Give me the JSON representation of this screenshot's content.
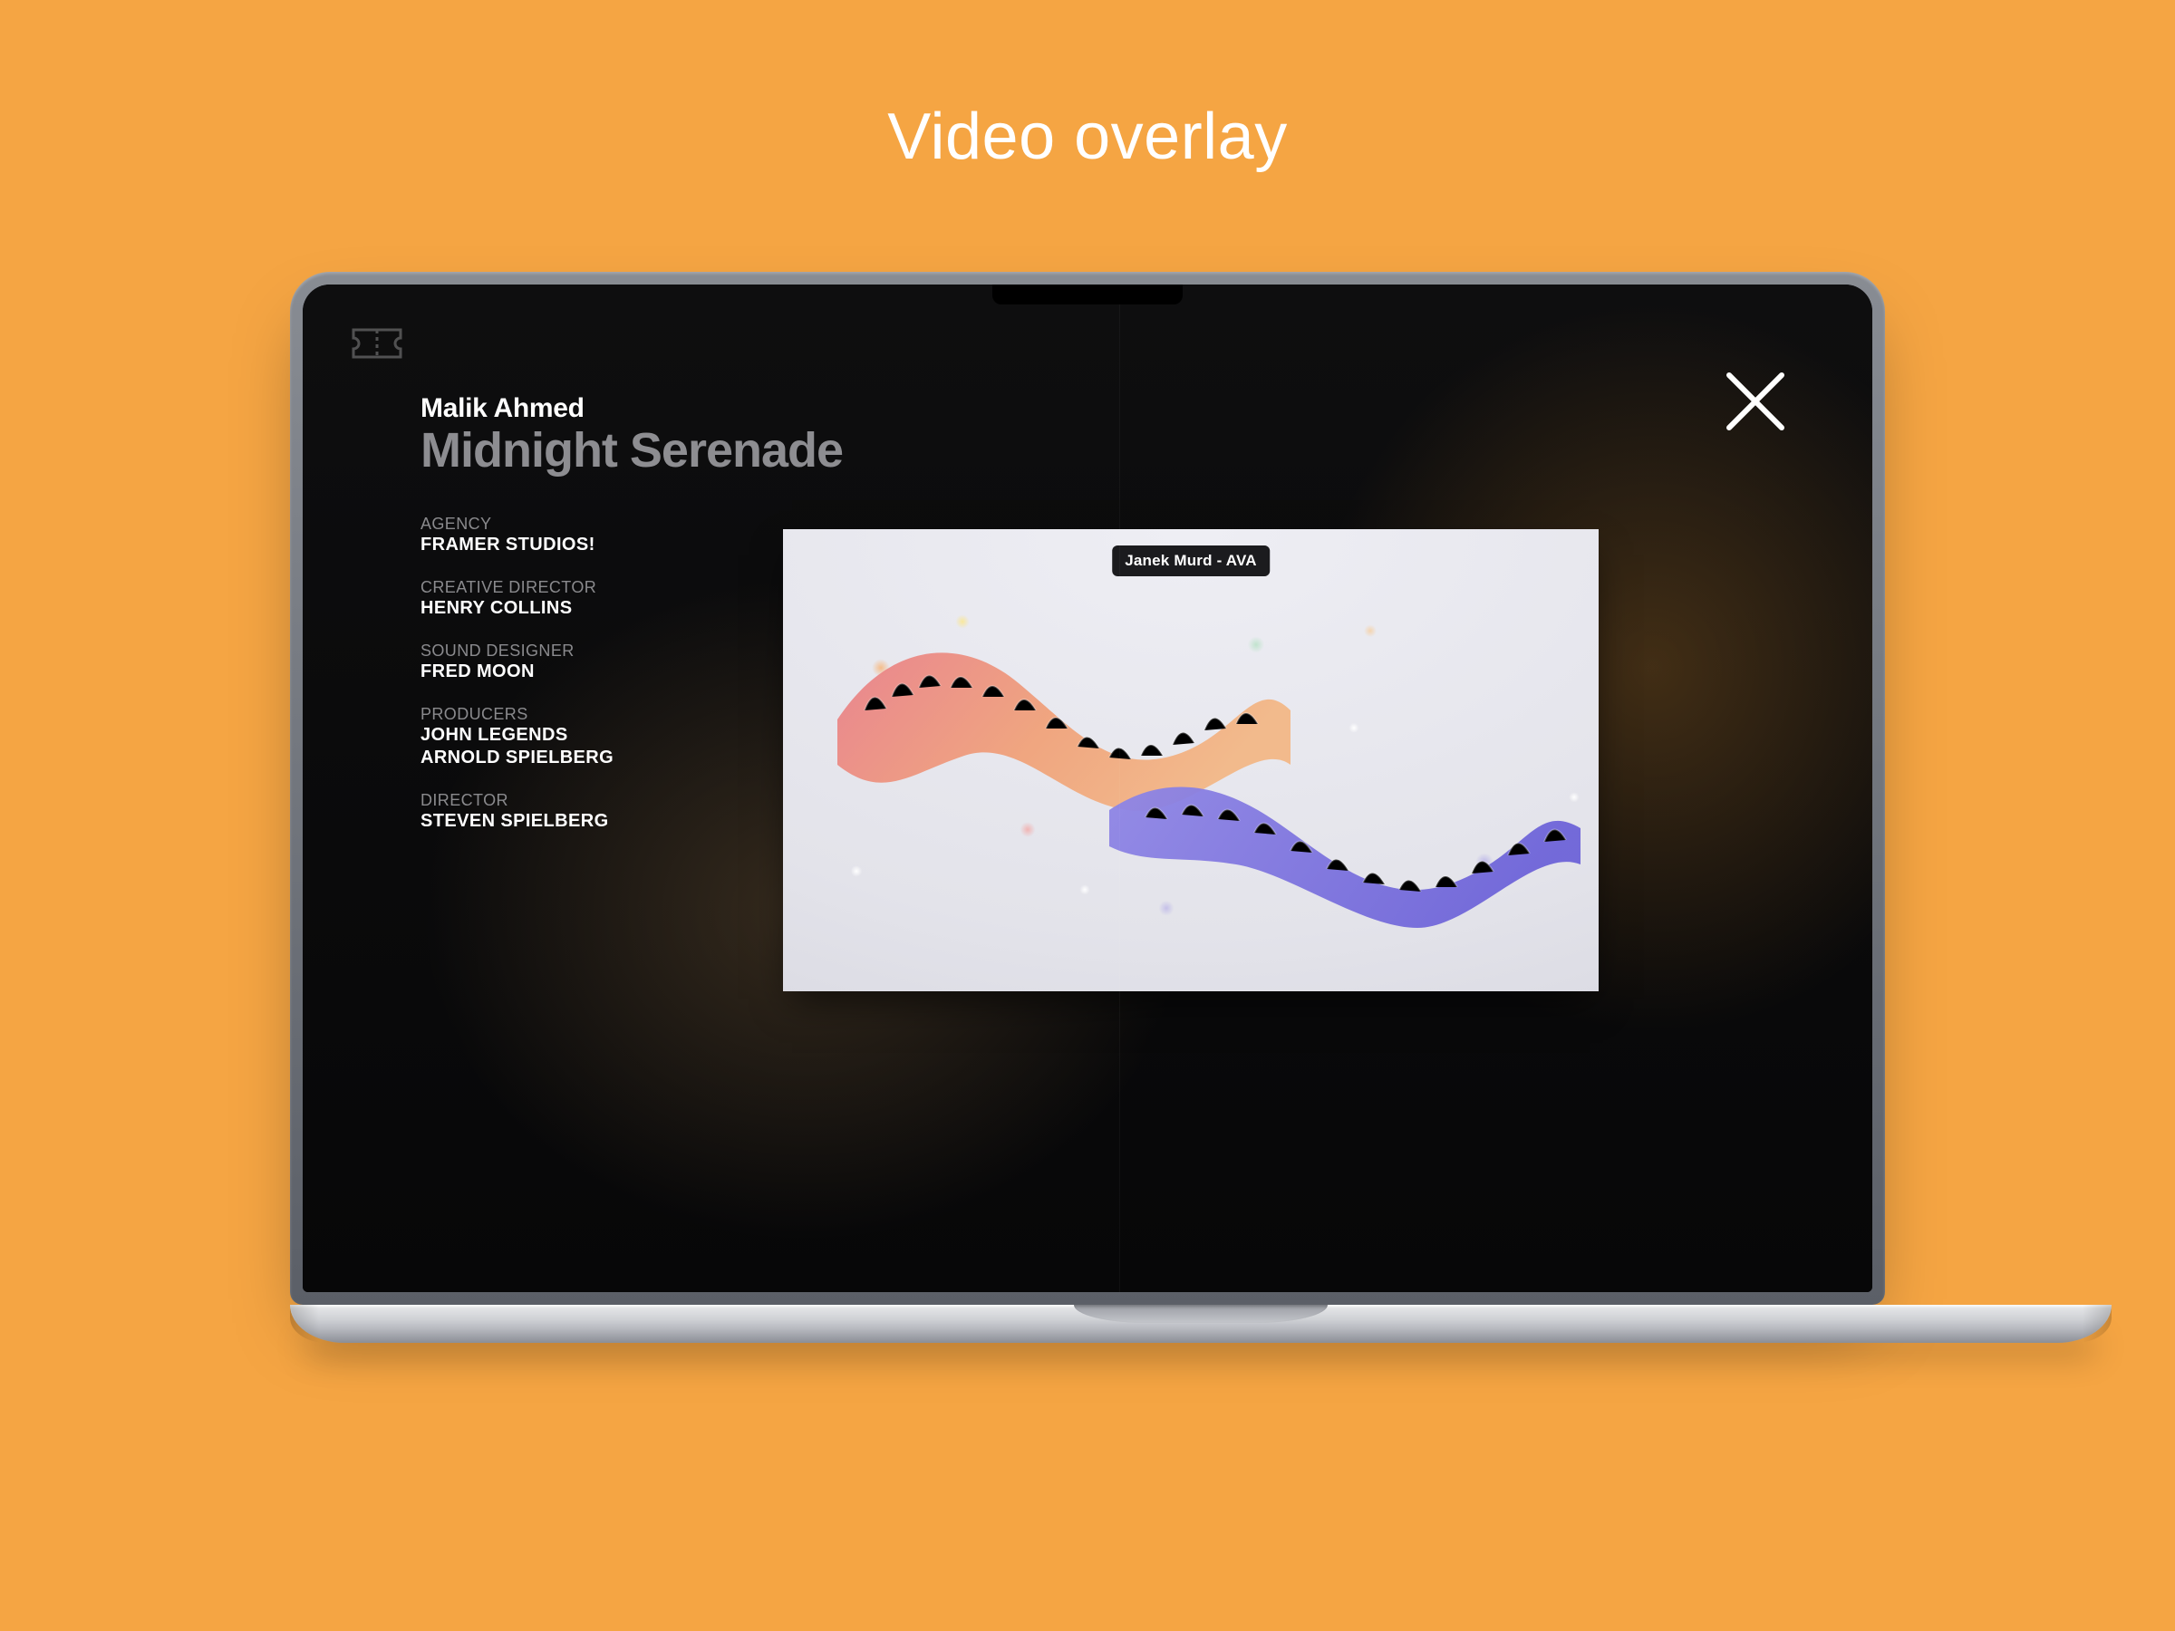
{
  "page_heading": "Video overlay",
  "overlay": {
    "artist": "Malik Ahmed",
    "title": "Midnight Serenade",
    "video_chip": "Janek Murd - AVA",
    "credits": [
      {
        "label": "AGENCY",
        "value": "FRAMER STUDIOS!"
      },
      {
        "label": "CREATIVE DIRECTOR",
        "value": "HENRY COLLINS"
      },
      {
        "label": "SOUND DESIGNER",
        "value": "FRED MOON"
      },
      {
        "label": "PRODUCERS",
        "value": "JOHN LEGENDS\nARNOLD SPIELBERG"
      },
      {
        "label": "DIRECTOR",
        "value": "STEVEN SPIELBERG"
      }
    ]
  },
  "icons": {
    "logo": "ticket-icon",
    "close": "close-icon"
  }
}
